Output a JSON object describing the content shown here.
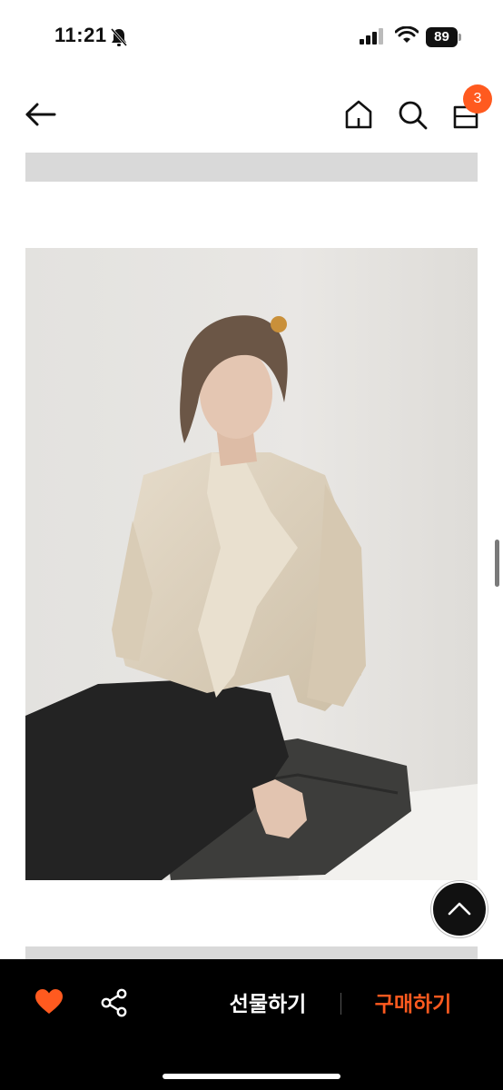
{
  "status_bar": {
    "time": "11:21",
    "battery": "89"
  },
  "nav": {
    "icons": [
      "back-arrow-icon",
      "home-icon",
      "search-icon",
      "shopping-bag-icon"
    ],
    "cart_count": "3"
  },
  "content": {
    "image_alt": "Model wearing a beige blouse with scarf tie and black pants, seated on a dark cushion"
  },
  "bottom_bar": {
    "icons": [
      "heart-icon",
      "share-icon"
    ],
    "gift_label": "선물하기",
    "buy_label": "구매하기"
  },
  "colors": {
    "accent": "#ff5a1f",
    "bottom_bar_bg": "#000000",
    "image_bg": "#e7e5e2",
    "placeholder_gray": "#d9d9d9"
  }
}
